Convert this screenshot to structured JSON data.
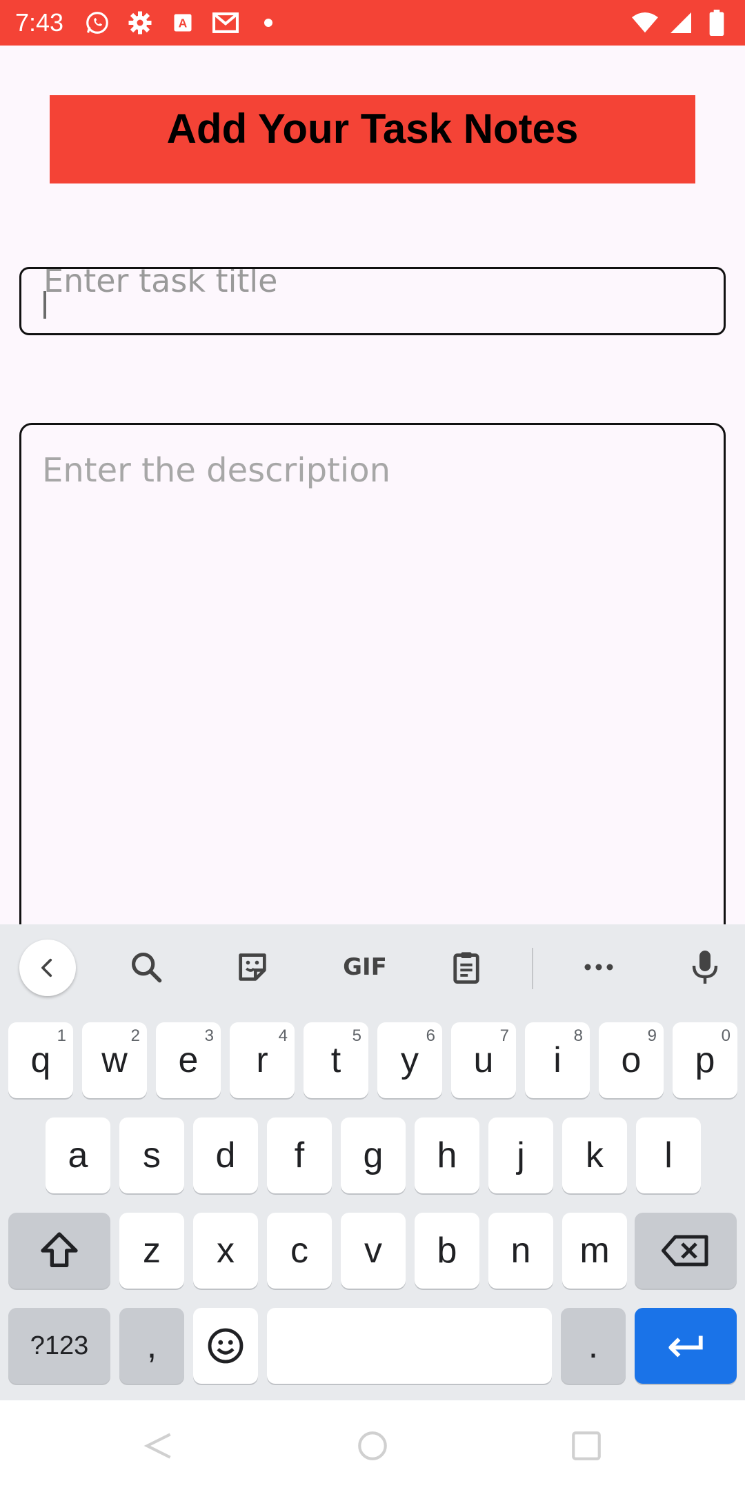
{
  "status_bar": {
    "time": "7:43",
    "icons": [
      "whatsapp-icon",
      "settings-icon",
      "text-a-icon",
      "gmail-icon",
      "dot-icon"
    ],
    "right_icons": [
      "wifi-icon",
      "signal-icon",
      "battery-icon"
    ],
    "color": "#f44336"
  },
  "header": {
    "title": "Add Your Task Notes",
    "background": "#f44336"
  },
  "form": {
    "title_placeholder": "Enter task title",
    "description_placeholder": "Enter the description"
  },
  "keyboard": {
    "toolbar": [
      "back-icon",
      "search-icon",
      "sticker-icon",
      "gif-icon",
      "clipboard-icon",
      "more-icon",
      "mic-icon"
    ],
    "gif_label": "GIF",
    "row1": [
      {
        "label": "q",
        "hint": "1"
      },
      {
        "label": "w",
        "hint": "2"
      },
      {
        "label": "e",
        "hint": "3"
      },
      {
        "label": "r",
        "hint": "4"
      },
      {
        "label": "t",
        "hint": "5"
      },
      {
        "label": "y",
        "hint": "6"
      },
      {
        "label": "u",
        "hint": "7"
      },
      {
        "label": "i",
        "hint": "8"
      },
      {
        "label": "o",
        "hint": "9"
      },
      {
        "label": "p",
        "hint": "0"
      }
    ],
    "row2": [
      "a",
      "s",
      "d",
      "f",
      "g",
      "h",
      "j",
      "k",
      "l"
    ],
    "row3": [
      "z",
      "x",
      "c",
      "v",
      "b",
      "n",
      "m"
    ],
    "symbols_label": "?123",
    "comma_label": ",",
    "period_label": ".",
    "enter_color": "#1a73e8"
  },
  "nav_bar": {
    "buttons": [
      "back-nav-icon",
      "home-nav-icon",
      "recents-nav-icon"
    ]
  }
}
